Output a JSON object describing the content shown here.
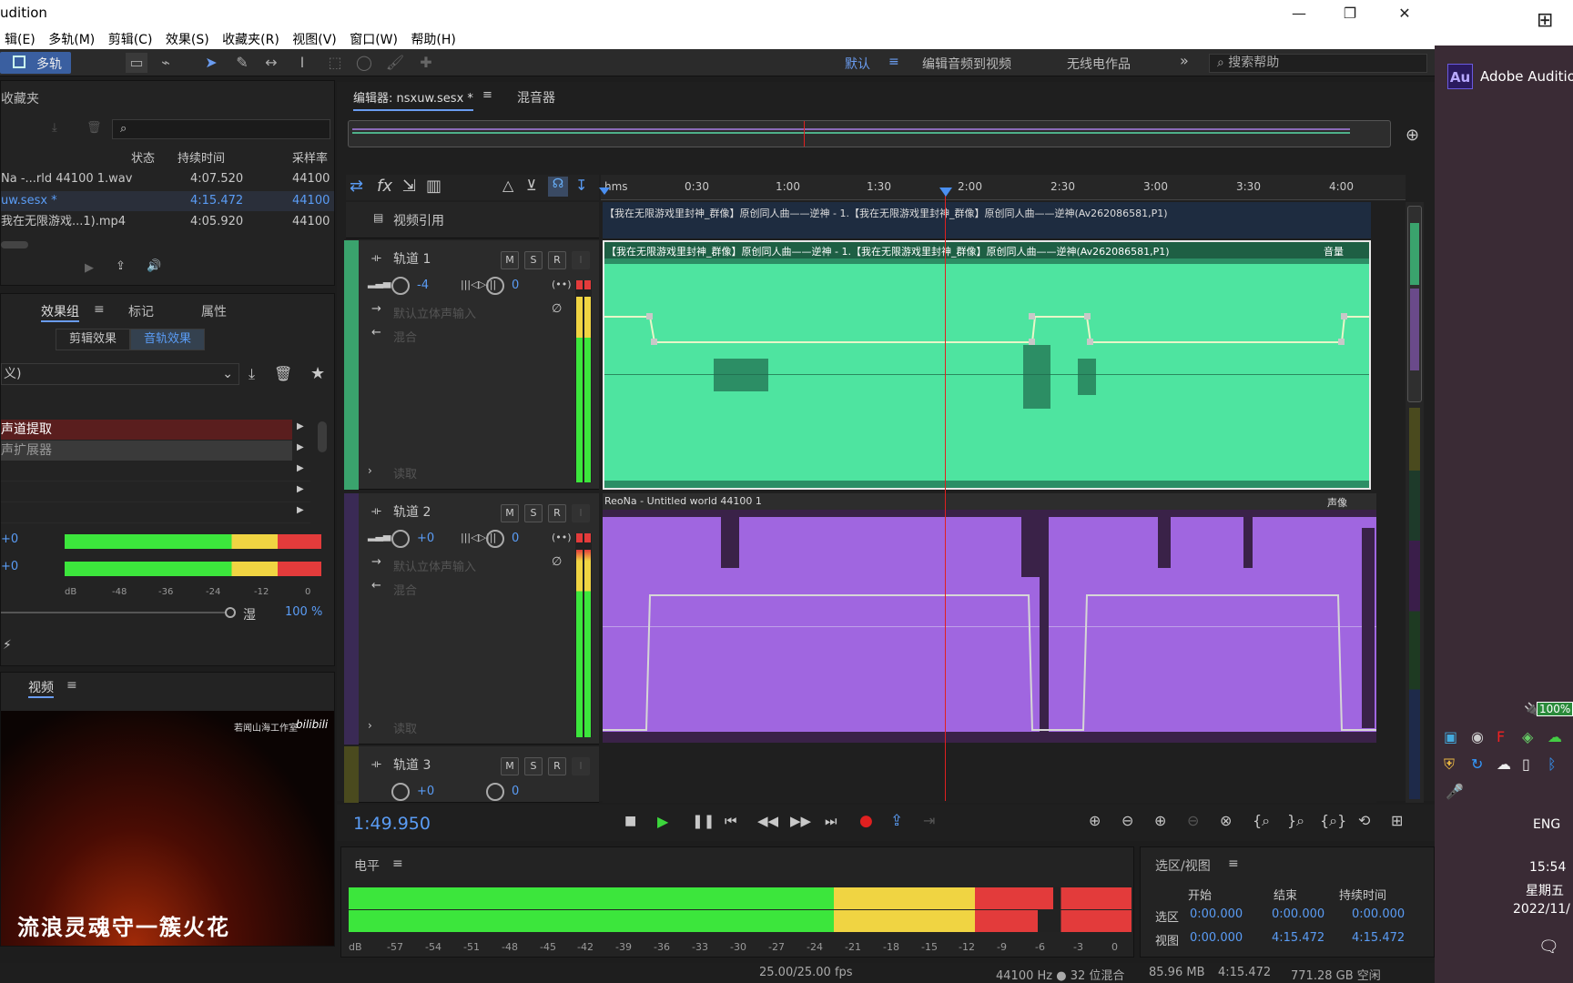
{
  "window": {
    "title": "udition",
    "minimize": "—",
    "restore": "❐",
    "close": "✕"
  },
  "menu": [
    "辑(E)",
    "多轨(M)",
    "剪辑(C)",
    "效果(S)",
    "收藏夹(R)",
    "视图(V)",
    "窗口(W)",
    "帮助(H)"
  ],
  "toolbar": {
    "mode_label": "多轨"
  },
  "workspaces": {
    "default": "默认",
    "menu_icon": "≡",
    "edit_video": "编辑音频到视频",
    "radio": "无线电作品",
    "more": "»",
    "search_placeholder": "搜索帮助"
  },
  "favorites": {
    "title": "收藏夹"
  },
  "files": {
    "columns": [
      "状态",
      "持续时间",
      "采样率"
    ],
    "rows": [
      {
        "name": "Na -...rld 44100 1.wav",
        "duration": "4:07.520",
        "rate": "44100",
        "active": false
      },
      {
        "name": "uw.sesx *",
        "duration": "4:15.472",
        "rate": "44100",
        "active": true
      },
      {
        "name": "我在无限游戏...1).mp4",
        "duration": "4:05.920",
        "rate": "44100",
        "active": false
      }
    ]
  },
  "effects": {
    "tabs": [
      "效果组",
      "标记",
      "属性"
    ],
    "menu_icon": "≡",
    "subtabs": [
      "剪辑效果",
      "音轨效果"
    ],
    "preset": "义)",
    "items": [
      "声道提取",
      "声扩展器",
      "",
      "",
      "",
      ""
    ],
    "meter_labels": [
      "+0",
      "+0"
    ],
    "scale": [
      "dB",
      "-48",
      "-36",
      "-24",
      "-12",
      "0"
    ],
    "wet_label": "湿",
    "wet_value": "100 %"
  },
  "video": {
    "title": "视频",
    "menu_icon": "≡",
    "watermark": "若闻山海工作室",
    "logo": "bilibili",
    "caption": "流浪灵魂守一簇火花"
  },
  "editor": {
    "tab_label": "编辑器: nsxuw.sesx *",
    "menu_icon": "≡",
    "mixer_label": "混音器",
    "ruler": [
      "hms",
      "0:30",
      "1:00",
      "1:30",
      "2:00",
      "2:30",
      "3:00",
      "3:30",
      "4:00"
    ],
    "video_ref": "视频引用",
    "tracks": [
      {
        "name": "轨道 1",
        "vol": "-4",
        "pan": "0",
        "input": "默认立体声输入",
        "output": "混合",
        "read": "读取",
        "clip_title": "【我在无限游戏里封神_群像】原创同人曲——逆神 - 1.【我在无限游戏里封神_群像】原创同人曲——逆神(Av262086581,P1)",
        "param": "音量"
      },
      {
        "name": "轨道 2",
        "vol": "+0",
        "pan": "0",
        "input": "默认立体声输入",
        "output": "混合",
        "read": "读取",
        "clip_title": "ReoNa - Untitled world 44100 1",
        "param": "声像"
      },
      {
        "name": "轨道 3",
        "vol": "+0",
        "pan": "0"
      }
    ],
    "video_clip_title": "【我在无限游戏里封神_群像】原创同人曲——逆神 - 1.【我在无限游戏里封神_群像】原创同人曲——逆神(Av262086581,P1)",
    "buttons": {
      "m": "M",
      "s": "S",
      "r": "R",
      "i": "I"
    },
    "time": "1:49.950"
  },
  "levels": {
    "title": "电平",
    "menu_icon": "≡",
    "scale": [
      "dB",
      "-57",
      "-54",
      "-51",
      "-48",
      "-45",
      "-42",
      "-39",
      "-36",
      "-33",
      "-30",
      "-27",
      "-24",
      "-21",
      "-18",
      "-15",
      "-12",
      "-9",
      "-6",
      "-3",
      "0"
    ]
  },
  "selection": {
    "title": "选区/视图",
    "menu_icon": "≡",
    "cols": [
      "开始",
      "结束",
      "持续时间"
    ],
    "rows": [
      {
        "label": "选区",
        "start": "0:00.000",
        "end": "0:00.000",
        "dur": "0:00.000"
      },
      {
        "label": "视图",
        "start": "0:00.000",
        "end": "4:15.472",
        "dur": "4:15.472"
      }
    ]
  },
  "status": {
    "fps": "25.00/25.00 fps",
    "format": "44100 Hz ● 32 位混合",
    "size": "85.96 MB",
    "duration": "4:15.472",
    "free": "771.28 GB 空闲"
  },
  "taskbar": {
    "app": "Adobe Auditio",
    "app_badge": "Au",
    "battery": "100%",
    "lang": "ENG",
    "time": "15:54",
    "weekday": "星期五",
    "date": "2022/11/"
  },
  "colors": {
    "track1": "#4ee4a0",
    "track2": "#a066e0",
    "playhead": "#e02020",
    "accent": "#4a8ff0"
  }
}
